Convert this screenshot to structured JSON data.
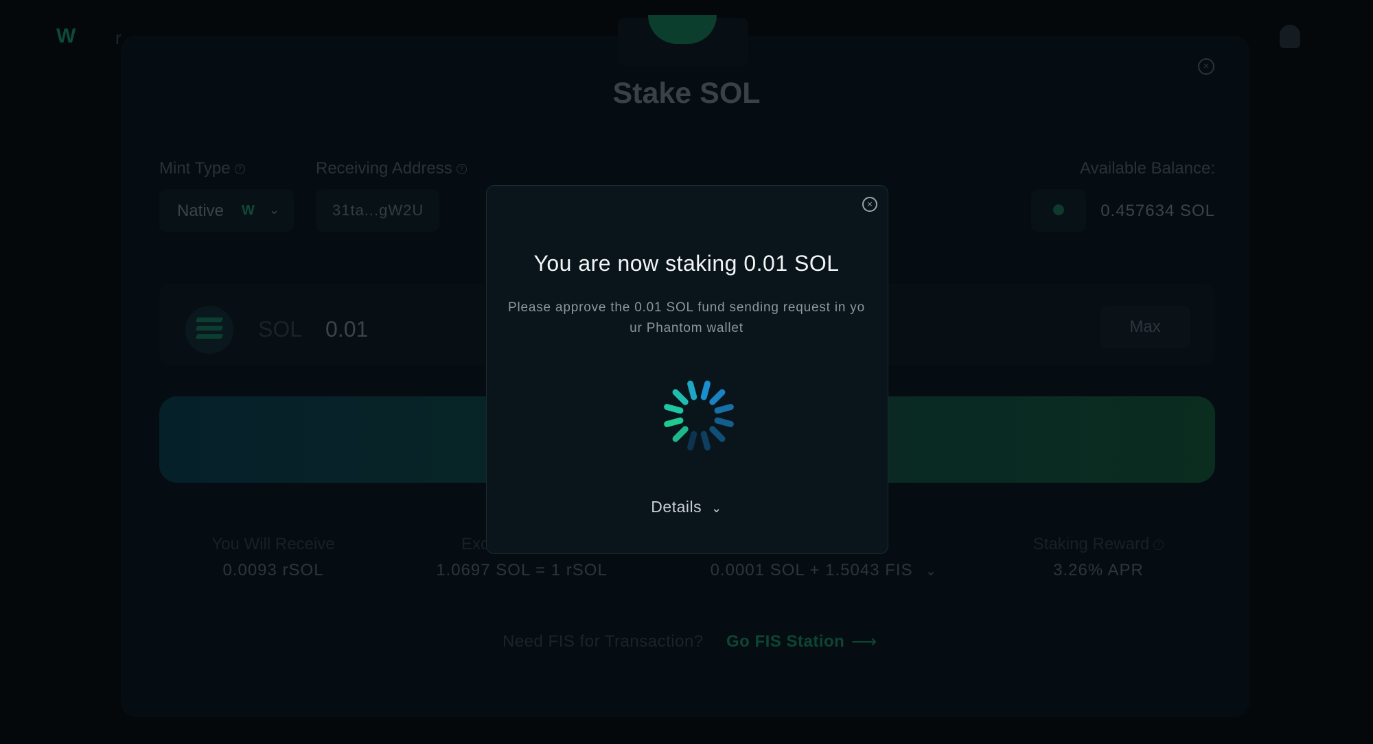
{
  "header": {
    "logo_letter": "W",
    "logo_rest": "r"
  },
  "page": {
    "title": "Stake SOL",
    "mint_type": {
      "label": "Mint Type",
      "value": "Native",
      "badge": "W"
    },
    "receiving_address": {
      "label": "Receiving Address",
      "value": "31ta...gW2U"
    },
    "balance": {
      "label": "Available Balance:",
      "value": "0.457634 SOL"
    },
    "amount": {
      "token": "SOL",
      "value": "0.01",
      "max_label": "Max"
    },
    "stats": [
      {
        "label": "You Will Receive",
        "value": "0.0093 rSOL"
      },
      {
        "label": "Exc",
        "value": "1.0697 SOL = 1 rSOL"
      },
      {
        "label": "",
        "value": "0.0001 SOL + 1.5043 FIS"
      },
      {
        "label": "Staking Reward",
        "value": "3.26% APR"
      }
    ],
    "fis": {
      "question": "Need FIS for Transaction?",
      "link": "Go FIS Station"
    }
  },
  "modal": {
    "title": "You are now staking 0.01 SOL",
    "description": "Please approve the 0.01 SOL fund sending request in your Phantom wallet",
    "details_label": "Details"
  },
  "colors": {
    "accent_green": "#0d4532",
    "spinner_blue": "#1a8fd0",
    "spinner_green": "#1fc98f"
  }
}
